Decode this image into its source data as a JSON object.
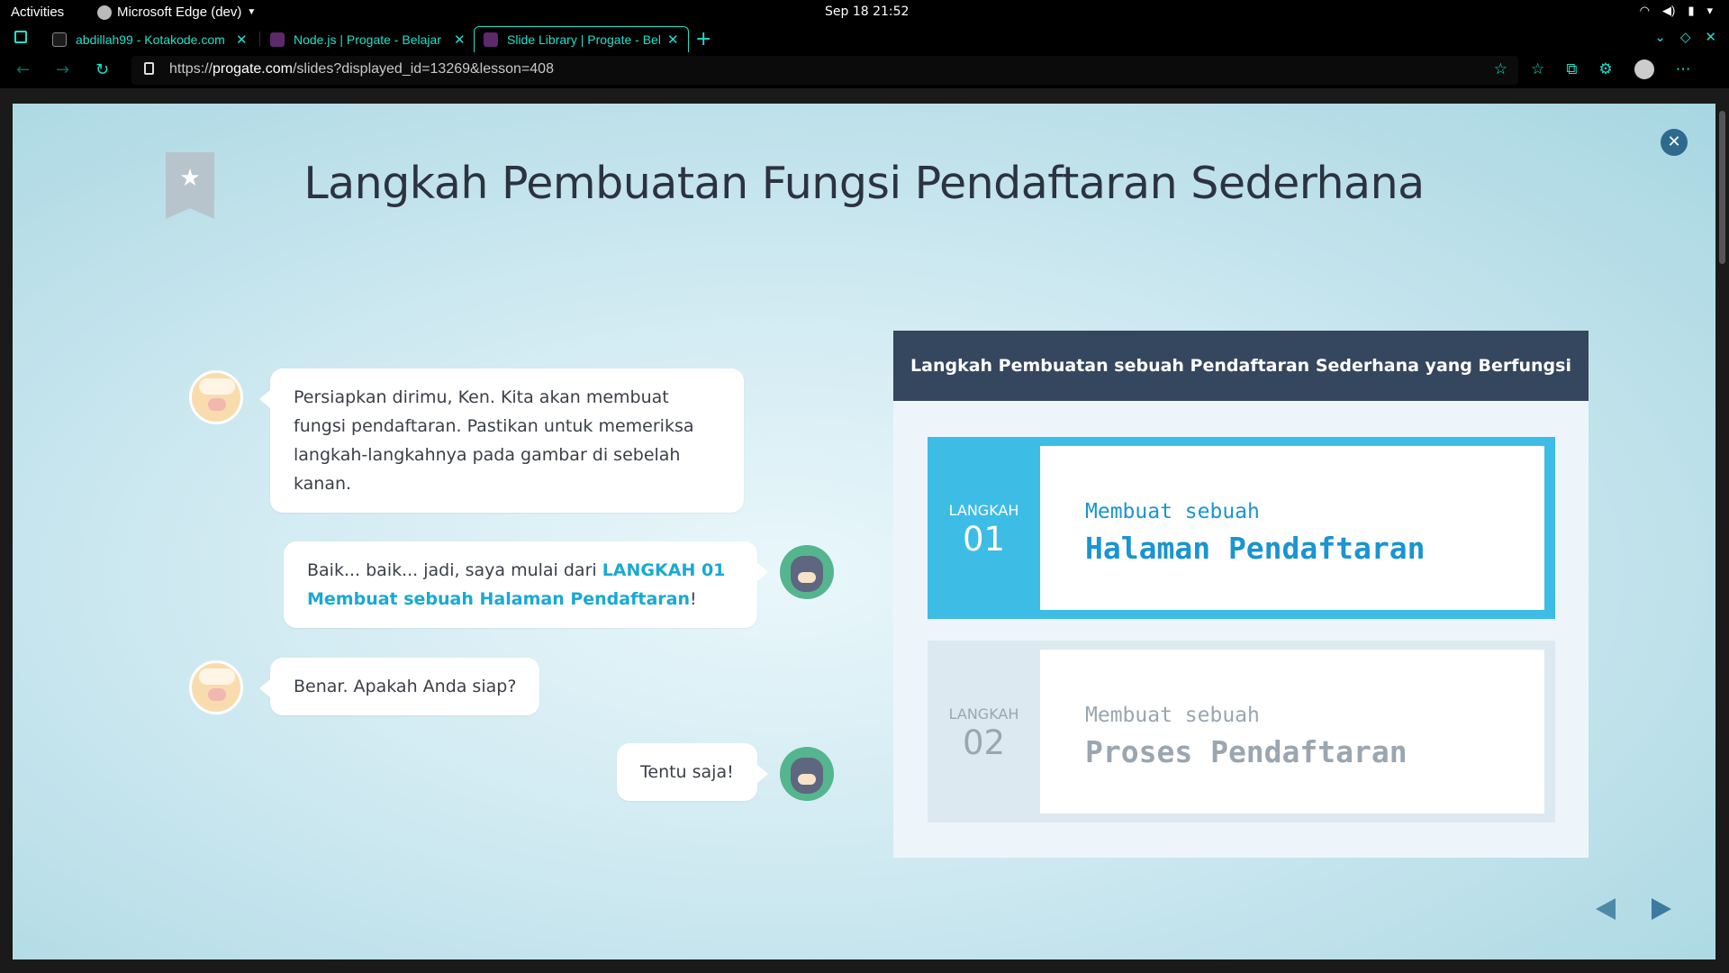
{
  "system": {
    "activities": "Activities",
    "app_name": "Microsoft Edge (dev)",
    "clock": "Sep 18  21:52"
  },
  "tabs": [
    {
      "label": "abdillah99 - Kotakode.com",
      "favicon_color": "#1c1c1c",
      "active": false
    },
    {
      "label": "Node.js | Progate - Belajar",
      "favicon_color": "#5c2a6b",
      "active": false
    },
    {
      "label": "Slide Library | Progate - Belajar",
      "favicon_color": "#5c2a6b",
      "active": true
    }
  ],
  "address_bar": {
    "url_prefix": "https://",
    "url_domain": "progate.com",
    "url_path": "/slides?displayed_id=13269&lesson=408"
  },
  "slide": {
    "title": "Langkah Pembuatan Fungsi Pendaftaran Sederhana",
    "chat": [
      {
        "speaker": "sheep",
        "side": "left",
        "text": "Persiapkan dirimu, Ken. Kita akan membuat fungsi pendaftaran. Pastikan untuk memeriksa langkah-langkahnya pada gambar di sebelah kanan."
      },
      {
        "speaker": "cat",
        "side": "right",
        "text_before": "Baik... baik... jadi, saya mulai dari ",
        "highlight": "LANGKAH 01 Membuat sebuah Halaman Pendaftaran",
        "text_after": "!"
      },
      {
        "speaker": "sheep",
        "side": "left",
        "text": "Benar. Apakah Anda siap?"
      },
      {
        "speaker": "cat",
        "side": "right",
        "text": "Tentu saja!"
      }
    ],
    "figure": {
      "heading": "Langkah Pembuatan sebuah Pendaftaran Sederhana yang Berfungsi",
      "steps": [
        {
          "word": "LANGKAH",
          "number": "01",
          "subtitle": "Membuat sebuah",
          "title": "Halaman Pendaftaran",
          "active": true
        },
        {
          "word": "LANGKAH",
          "number": "02",
          "subtitle": "Membuat sebuah",
          "title": "Proses Pendaftaran",
          "active": false
        }
      ]
    },
    "icons": {
      "bookmark": "bookmark-star-icon",
      "close": "close-icon",
      "prev": "prev-arrow-icon",
      "next": "next-arrow-icon"
    }
  }
}
